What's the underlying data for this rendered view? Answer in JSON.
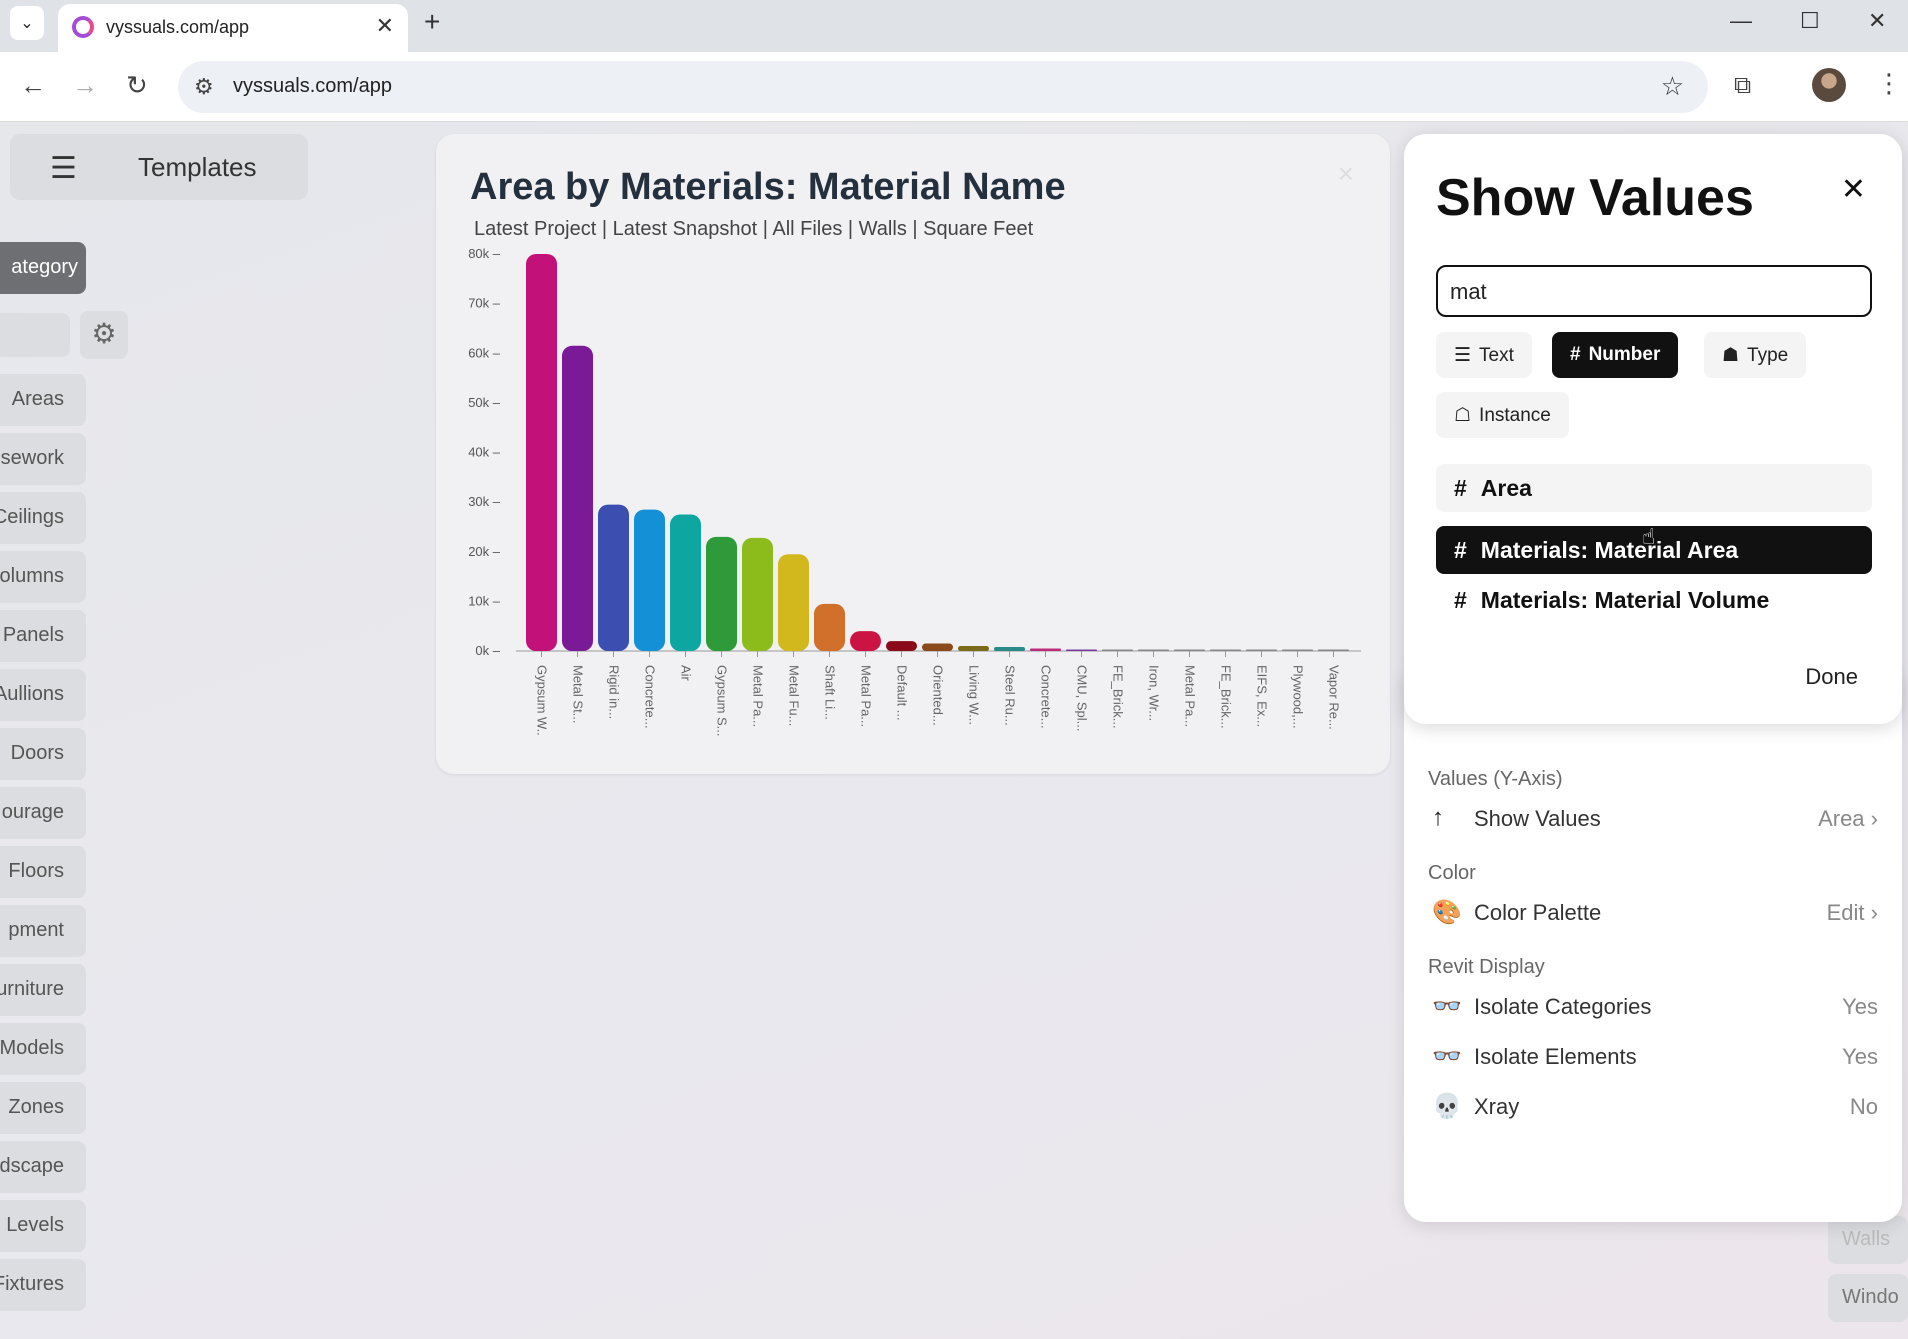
{
  "browser": {
    "tab_title": "vyssuals.com/app",
    "url": "vyssuals.com/app"
  },
  "app": {
    "templates_label": "Templates",
    "category_label": "ategory",
    "categories": [
      "Areas",
      "sework",
      "Ceilings",
      "olumns",
      "Panels",
      "Aullions",
      "Doors",
      "ourage",
      "Floors",
      "pment",
      "urniture",
      "Models",
      "Zones",
      "dscape",
      "Levels",
      "Fixtures"
    ]
  },
  "chart": {
    "title": "Area by Materials: Material Name",
    "subtitle": "Latest Project | Latest Snapshot | All Files | Walls | Square Feet",
    "close": "×"
  },
  "chart_data": {
    "type": "bar",
    "title": "Area by Materials: Material Name",
    "subtitle": "Latest Project | Latest Snapshot | All Files | Walls | Square Feet",
    "xlabel": "",
    "ylabel": "",
    "ylim": [
      0,
      80000
    ],
    "yticks": [
      "0k",
      "10k",
      "20k",
      "30k",
      "40k",
      "50k",
      "60k",
      "70k",
      "80k"
    ],
    "grid": false,
    "categories": [
      "Gypsum W..",
      "Metal St...",
      "Rigid in...",
      "Concrete...",
      "Air",
      "Gypsum S...",
      "Metal Pa...",
      "Metal Fu...",
      "Shaft Li...",
      "Metal Pa...",
      "Default ...",
      "Oriented...",
      "Living W...",
      "Steel Ru...",
      "Concrete...",
      "CMU, Spl...",
      "FE_Brick...",
      "Iron, Wr...",
      "Metal Pa...",
      "FE_Brick...",
      "EIFS, Ex...",
      "Plywood,...",
      "Vapor Re..."
    ],
    "values": [
      80000,
      61500,
      29500,
      28500,
      27500,
      23000,
      22800,
      19500,
      9500,
      4000,
      2000,
      1500,
      1000,
      800,
      500,
      300,
      100,
      80,
      60,
      50,
      40,
      30,
      20
    ],
    "colors": [
      "#c2127a",
      "#7b1a96",
      "#3b4fb0",
      "#1390d6",
      "#0ea6a0",
      "#2f9a3a",
      "#8cbc1c",
      "#d2b81c",
      "#d0702a",
      "#cc1444",
      "#8a0a1a",
      "#8a4a1a",
      "#7a6a1a",
      "#2a8a8a",
      "#c02a7a",
      "#7a3aa0",
      "#888888",
      "#888888",
      "#888888",
      "#888888",
      "#888888",
      "#888888",
      "#888888"
    ]
  },
  "show_values": {
    "title": "Show Values",
    "close": "✕",
    "search_value": "mat",
    "chips": [
      {
        "icon": "☰",
        "label": "Text",
        "active": false
      },
      {
        "icon": "#",
        "label": "Number",
        "active": true
      },
      {
        "icon": "☗",
        "label": "Type",
        "active": false
      },
      {
        "icon": "☖",
        "label": "Instance",
        "active": false
      }
    ],
    "options": [
      {
        "label": "Area",
        "state": "plain"
      },
      {
        "label": "Materials: Material Area",
        "state": "selected"
      },
      {
        "label": "Materials: Material Volume",
        "state": "normal"
      }
    ],
    "done": "Done"
  },
  "settings": {
    "values_section": "Values (Y-Axis)",
    "show_values_label": "Show Values",
    "show_values_value": "Area",
    "color_section": "Color",
    "color_palette_label": "Color Palette",
    "color_palette_value": "Edit",
    "revit_section": "Revit Display",
    "isolate_categories_label": "Isolate Categories",
    "isolate_categories_value": "Yes",
    "isolate_elements_label": "Isolate Elements",
    "isolate_elements_value": "Yes",
    "xray_label": "Xray",
    "xray_value": "No"
  },
  "bottom": {
    "walls": "Walls",
    "windows": "Windo"
  }
}
